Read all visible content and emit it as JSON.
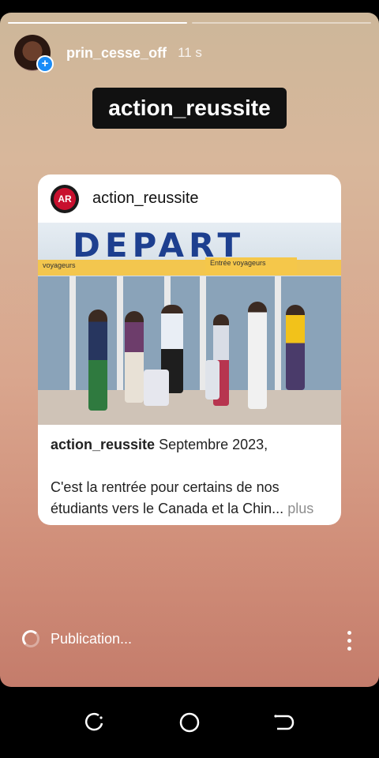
{
  "story": {
    "username": "prin_cesse_off",
    "time": "11 s",
    "progress": [
      1.0,
      0.0
    ],
    "mention": "action_reussite",
    "post": {
      "username": "action_reussite",
      "photo_sign": "DEPART",
      "photo_band_left": "voyageurs",
      "photo_band_right": "Entrée voyageurs",
      "caption_user": "action_reussite",
      "caption_line1": "Septembre 2023,",
      "caption_line2": "C'est la rentrée pour certains de nos",
      "caption_line3": "étudiants vers le Canada et la Chin...",
      "more": "plus"
    },
    "status": "Publication..."
  },
  "colors": {
    "story_top": "#cdb79a",
    "story_bottom": "#c47c6b",
    "accent_blue": "#1a8cf8",
    "sign_blue": "#1d3f8f"
  },
  "icons": {
    "add": "plus-icon",
    "options": "more-vertical-icon",
    "loading": "spinner-icon",
    "nav_recent": "recent-apps-icon",
    "nav_home": "home-icon",
    "nav_back": "back-icon"
  }
}
